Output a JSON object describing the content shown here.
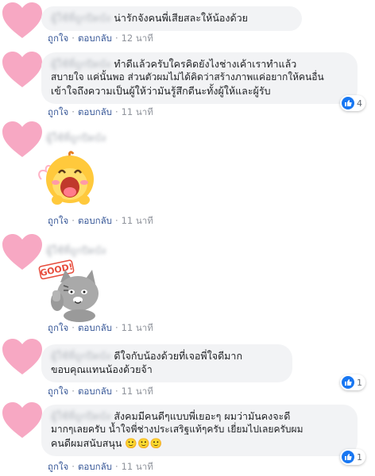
{
  "comments": [
    {
      "name": "ผู้ใช้ที่ถูกปิดบัง",
      "text": "น่ารักจังคนพี่เสียสละให้น้องด้วย",
      "like_label": "ถูกใจ",
      "reply_label": "ตอบกลับ",
      "time": "12 นาที"
    },
    {
      "name": "ผู้ใช้ที่ถูกปิดบัง",
      "line1": "ทำดีแล้วครับใครคิดยังไงช่างเค้าเราทำแล้ว",
      "line2": "สบายใจ แค่นั้นพอ ส่วนตัวผมไม่ได้คิดว่าสร้างภาพแค่อยากให้คนอื่น",
      "line3": "เข้าใจถึงความเป็นผู้ให้ว่ามันรู้สึกดีนะทั้งผู้ให้และผู้รับ",
      "like_label": "ถูกใจ",
      "reply_label": "ตอบกลับ",
      "time": "11 นาที",
      "reaction_count": "4"
    },
    {
      "name": "ผู้ใช้ที่ถูกปิดบัง",
      "sticker": "laughing-chick-sticker",
      "like_label": "ถูกใจ",
      "reply_label": "ตอบกลับ",
      "time": "11 นาที"
    },
    {
      "name": "ผู้ใช้ที่ถูกปิดบัง",
      "sticker": "good-cat-sticker",
      "sticker_text": "GOOD!",
      "like_label": "ถูกใจ",
      "reply_label": "ตอบกลับ",
      "time": "11 นาที"
    },
    {
      "name": "ผู้ใช้ที่ถูกปิดบัง",
      "line1": "ดีใจกับน้องด้วยที่เจอพี่ใจดีมาก",
      "line2": "ขอบคุณแทนน้องด้วยจ้า",
      "like_label": "ถูกใจ",
      "reply_label": "ตอบกลับ",
      "time": "11 นาที",
      "reaction_count": "1"
    },
    {
      "name": "ผู้ใช้ที่ถูกปิดบัง",
      "line1": "สังคมมีคนดีๆแบบพี่เยอะๆ ผมว่ามันคงจะดี",
      "line2": "มากๆเลยครับ น้ำใจพี่ช่างประเสริฐแท้ๆครับ เยี่ยมไปเลยครับผม",
      "line3": "คนดีผมสนับสนุน",
      "emoji": "🙂🙂🙂",
      "like_label": "ถูกใจ",
      "reply_label": "ตอบกลับ",
      "time": "11 นาที",
      "reaction_count": "1"
    }
  ],
  "colors": {
    "avatar_heart": "#f7a8c3",
    "bubble": "#f2f3f5",
    "link": "#385898",
    "like_blue": "#1877f2"
  }
}
